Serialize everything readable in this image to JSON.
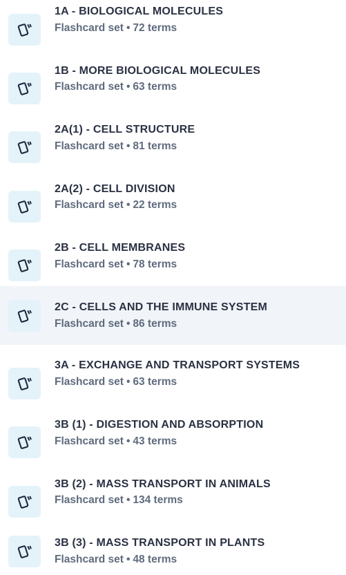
{
  "sets": [
    {
      "title": "1A - BIOLOGICAL MOLECULES",
      "type_label": "Flashcard set",
      "terms": "72 terms",
      "icon": "flashcards-icon"
    },
    {
      "title": "1B - MORE BIOLOGICAL MOLECULES",
      "type_label": "Flashcard set",
      "terms": "63 terms",
      "icon": "flashcards-icon"
    },
    {
      "title": "2A(1) - CELL STRUCTURE",
      "type_label": "Flashcard set",
      "terms": "81 terms",
      "icon": "flashcards-icon"
    },
    {
      "title": "2A(2) - CELL DIVISION",
      "type_label": "Flashcard set",
      "terms": "22 terms",
      "icon": "flashcards-icon"
    },
    {
      "title": "2B - CELL MEMBRANES",
      "type_label": "Flashcard set",
      "terms": "78 terms",
      "icon": "flashcards-icon"
    },
    {
      "title": "2C - CELLS AND THE IMMUNE SYSTEM",
      "type_label": "Flashcard set",
      "terms": "86 terms",
      "icon": "flashcards-icon",
      "highlighted": true
    },
    {
      "title": "3A - EXCHANGE AND TRANSPORT SYSTEMS",
      "type_label": "Flashcard set",
      "terms": "63 terms",
      "icon": "flashcards-icon"
    },
    {
      "title": "3B (1) - DIGESTION AND ABSORPTION",
      "type_label": "Flashcard set",
      "terms": "43 terms",
      "icon": "flashcards-icon"
    },
    {
      "title": "3B (2) - MASS TRANSPORT IN ANIMALS",
      "type_label": "Flashcard set",
      "terms": "134 terms",
      "icon": "flashcards-icon"
    },
    {
      "title": "3B (3) - MASS TRANSPORT IN PLANTS",
      "type_label": "Flashcard set",
      "terms": "48 terms",
      "icon": "flashcards-icon"
    }
  ],
  "separator": "•",
  "colors": {
    "icon_bg": "#e4f3fa",
    "icon_stroke": "#1b2a3d",
    "title": "#2a3142",
    "subtitle": "#5f6b7d",
    "highlight_bg": "#f1f4f8"
  }
}
